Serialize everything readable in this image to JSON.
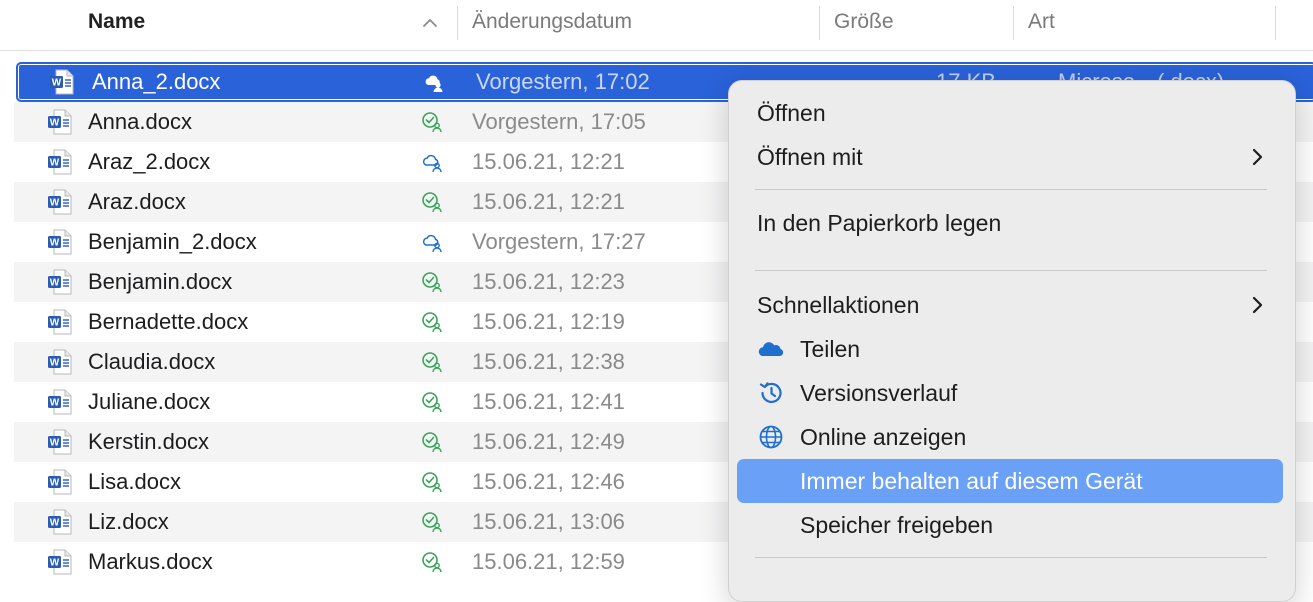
{
  "columns": {
    "name": "Name",
    "date": "Änderungsdatum",
    "size": "Größe",
    "kind": "Art"
  },
  "files": [
    {
      "name": "Anna_2.docx",
      "date": "Vorgestern, 17:02",
      "size": "17 KB",
      "kind": "Microso…(.docx)",
      "status": "cloud-shared-icon",
      "selected": true
    },
    {
      "name": "Anna.docx",
      "date": "Vorgestern, 17:05",
      "status": "synced-shared-icon"
    },
    {
      "name": "Araz_2.docx",
      "date": "15.06.21, 12:21",
      "status": "cloud-shared-icon"
    },
    {
      "name": "Araz.docx",
      "date": "15.06.21, 12:21",
      "status": "synced-shared-icon"
    },
    {
      "name": "Benjamin_2.docx",
      "date": "Vorgestern, 17:27",
      "status": "cloud-shared-icon"
    },
    {
      "name": "Benjamin.docx",
      "date": "15.06.21, 12:23",
      "status": "synced-shared-icon"
    },
    {
      "name": "Bernadette.docx",
      "date": "15.06.21, 12:19",
      "status": "synced-shared-icon"
    },
    {
      "name": "Claudia.docx",
      "date": "15.06.21, 12:38",
      "status": "synced-shared-icon"
    },
    {
      "name": "Juliane.docx",
      "date": "15.06.21, 12:41",
      "status": "synced-shared-icon"
    },
    {
      "name": "Kerstin.docx",
      "date": "15.06.21, 12:49",
      "status": "synced-shared-icon"
    },
    {
      "name": "Lisa.docx",
      "date": "15.06.21, 12:46",
      "status": "synced-shared-icon"
    },
    {
      "name": "Liz.docx",
      "date": "15.06.21, 13:06",
      "status": "synced-shared-icon"
    },
    {
      "name": "Markus.docx",
      "date": "15.06.21, 12:59",
      "status": "synced-shared-icon"
    }
  ],
  "context_menu": {
    "open": "Öffnen",
    "open_with": "Öffnen mit",
    "trash": "In den Papierkorb legen",
    "quick_actions": "Schnellaktionen",
    "share": "Teilen",
    "version_history": "Versionsverlauf",
    "view_online": "Online anzeigen",
    "always_keep": "Immer behalten auf diesem Gerät",
    "free_up_space": "Speicher freigeben"
  },
  "colors": {
    "selection": "#2a62d9",
    "menu_highlight": "#6aa0f6",
    "onedrive_blue": "#1e6fd1",
    "word_blue": "#2b5bb5",
    "sync_green": "#3aa35a"
  }
}
